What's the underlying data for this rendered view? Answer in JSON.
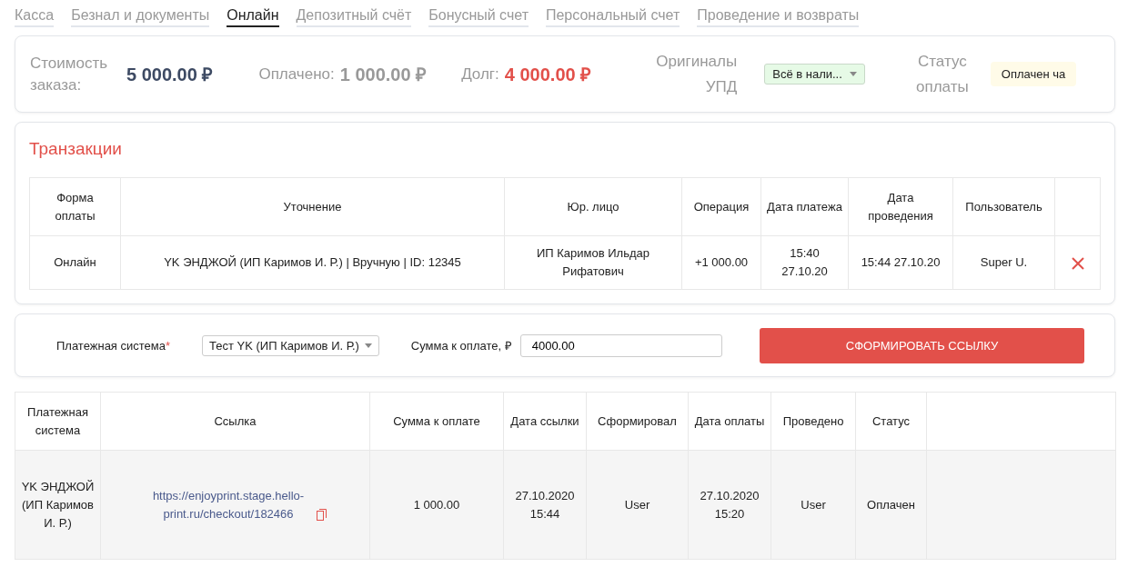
{
  "tabs": [
    {
      "label": "Касса",
      "selected": false
    },
    {
      "label": "Безнал и документы",
      "selected": false
    },
    {
      "label": "Онлайн",
      "selected": true
    },
    {
      "label": "Депозитный счёт",
      "selected": false
    },
    {
      "label": "Бонусный счет",
      "selected": false
    },
    {
      "label": "Персональный счет",
      "selected": false
    },
    {
      "label": "Проведение и возвраты",
      "selected": false
    }
  ],
  "summary": {
    "cost_label": "Стоимость заказа:",
    "cost_value": "5 000.00 ₽",
    "paid_label": "Оплачено:",
    "paid_value": "1 000.00 ₽",
    "debt_label": "Долг:",
    "debt_value": "4 000.00 ₽",
    "originals_label": "Оригиналы УПД",
    "originals_value": "Всё в нали...",
    "status_label": "Статус оплаты",
    "status_value": "Оплачен ча"
  },
  "transactions": {
    "title": "Транзакции",
    "columns": [
      "Форма оплаты",
      "Уточнение",
      "Юр. лицо",
      "Операция",
      "Дата платежа",
      "Дата проведения",
      "Пользователь"
    ],
    "rows": [
      {
        "cells": [
          "Онлайн",
          "YK ЭНДЖОЙ (ИП Каримов И. Р.) | Вручную | ID: 12345",
          "ИП Каримов Ильдар Рифатович",
          "+1 000.00",
          "15:40 27.10.20",
          "15:44 27.10.20",
          "Super U."
        ]
      }
    ]
  },
  "form": {
    "system_label": "Платежная система",
    "required_mark": "*",
    "system_value": "Тест YK (ИП Каримов И. Р.)",
    "amount_label": "Сумма к оплате, ₽",
    "amount_value": "4000.00",
    "button": "СФОРМИРОВАТЬ ССЫЛКУ"
  },
  "links": {
    "columns": [
      "Платежная система",
      "Ссылка",
      "Сумма к оплате",
      "Дата ссылки",
      "Сформировал",
      "Дата оплаты",
      "Проведено",
      "Статус"
    ],
    "rows": [
      {
        "system": "YK ЭНДЖОЙ (ИП Каримов И. Р.)",
        "link": "https://enjoyprint.stage.hello-print.ru/checkout/182466",
        "amount": "1 000.00",
        "link_date": "27.10.2020 15:44",
        "created_by": "User",
        "paid_date": "27.10.2020 15:20",
        "conducted_by": "User",
        "status": "Оплачен"
      }
    ]
  }
}
